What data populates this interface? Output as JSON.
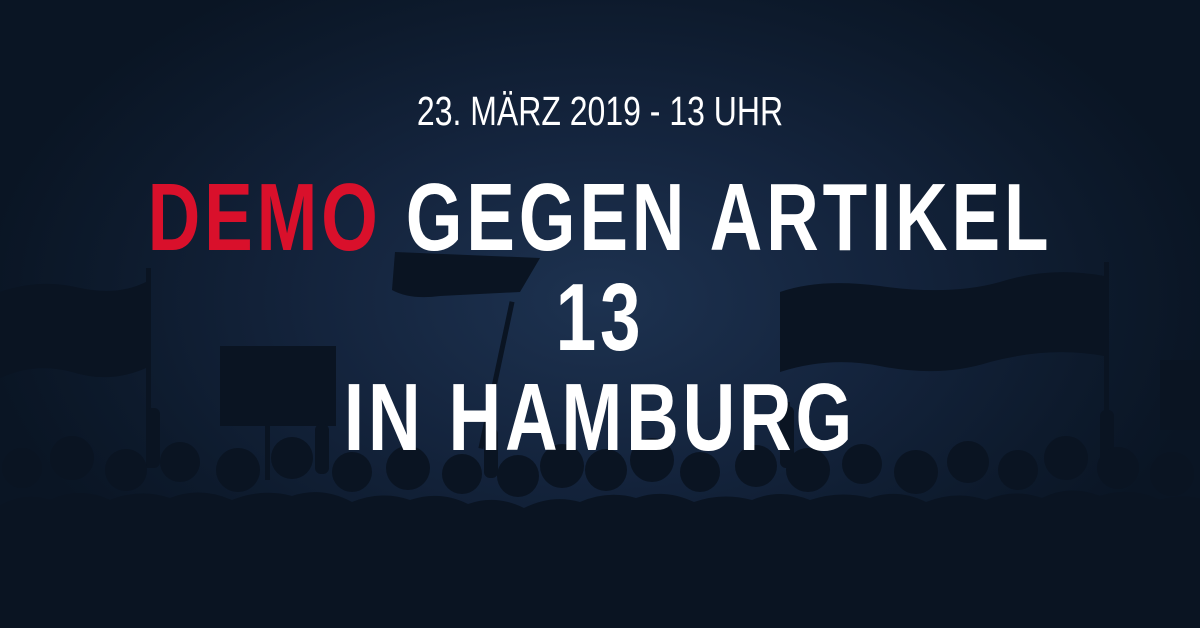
{
  "banner": {
    "date_line": "23. MÄRZ 2019 - 13 UHR",
    "headline_accent": "DEMO",
    "headline_rest": "GEGEN ARTIKEL 13",
    "headline_line2": "IN HAMBURG"
  },
  "colors": {
    "background": "#14243d",
    "silhouette": "#0a1422",
    "accent": "#d9102b",
    "text": "#ffffff"
  }
}
